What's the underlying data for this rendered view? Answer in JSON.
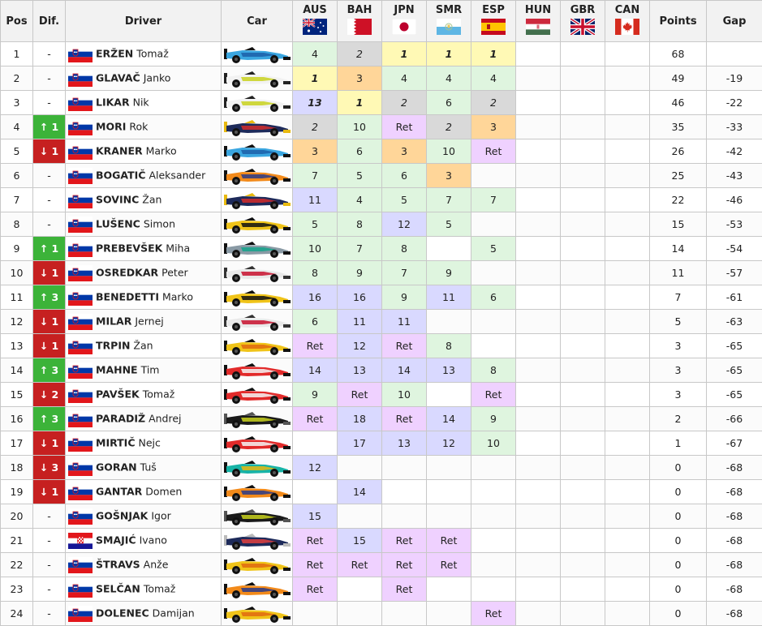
{
  "headers": {
    "pos": "Pos",
    "dif": "Dif.",
    "driver": "Driver",
    "car": "Car",
    "points": "Points",
    "gap": "Gap",
    "races": [
      {
        "code": "AUS",
        "flag": "au"
      },
      {
        "code": "BAH",
        "flag": "bh"
      },
      {
        "code": "JPN",
        "flag": "jp"
      },
      {
        "code": "SMR",
        "flag": "sm"
      },
      {
        "code": "ESP",
        "flag": "es"
      },
      {
        "code": "HUN",
        "flag": "hu"
      },
      {
        "code": "GBR",
        "flag": "gb"
      },
      {
        "code": "CAN",
        "flag": "ca"
      }
    ]
  },
  "colors": {
    "win": "#fff9b5",
    "second": "#d9d9d9",
    "third": "#ffd699",
    "points": "#dff5df",
    "finished": "#d9d9ff",
    "retired": "#efd1ff",
    "up": "#3cb339",
    "down": "#c62020"
  },
  "rows": [
    {
      "pos": "1",
      "dif": "-",
      "flag": "si",
      "surname": "ERŽEN",
      "given": "Tomaž",
      "car": {
        "body": "#3aa6e0",
        "accent": "#1c5fa8",
        "wing": "#111111"
      },
      "results": [
        {
          "v": "4",
          "c": "pts"
        },
        {
          "v": "2",
          "c": "p2"
        },
        {
          "v": "1",
          "c": "win"
        },
        {
          "v": "1",
          "c": "win"
        },
        {
          "v": "1",
          "c": "win"
        },
        {
          "v": "",
          "c": ""
        },
        {
          "v": "",
          "c": ""
        },
        {
          "v": "",
          "c": ""
        }
      ],
      "points": "68",
      "gap": ""
    },
    {
      "pos": "2",
      "dif": "-",
      "flag": "si",
      "surname": "GLAVAČ",
      "given": "Janko",
      "car": {
        "body": "#f2f2f2",
        "accent": "#c9d21e",
        "wing": "#222222"
      },
      "results": [
        {
          "v": "1",
          "c": "win"
        },
        {
          "v": "3",
          "c": "p3"
        },
        {
          "v": "4",
          "c": "pts"
        },
        {
          "v": "4",
          "c": "pts"
        },
        {
          "v": "4",
          "c": "pts"
        },
        {
          "v": "",
          "c": ""
        },
        {
          "v": "",
          "c": ""
        },
        {
          "v": "",
          "c": ""
        }
      ],
      "points": "49",
      "gap": "-19"
    },
    {
      "pos": "3",
      "dif": "-",
      "flag": "si",
      "surname": "LIKAR",
      "given": "Nik",
      "car": {
        "body": "#f2f2f2",
        "accent": "#c9d21e",
        "wing": "#222222"
      },
      "results": [
        {
          "v": "13",
          "c": "fin pole"
        },
        {
          "v": "1",
          "c": "win"
        },
        {
          "v": "2",
          "c": "p2"
        },
        {
          "v": "6",
          "c": "pts"
        },
        {
          "v": "2",
          "c": "p2"
        },
        {
          "v": "",
          "c": ""
        },
        {
          "v": "",
          "c": ""
        },
        {
          "v": "",
          "c": ""
        }
      ],
      "points": "46",
      "gap": "-22"
    },
    {
      "pos": "4",
      "dif": "↑ 1",
      "dir": "up",
      "flag": "si",
      "surname": "MORI",
      "given": "Rok",
      "car": {
        "body": "#1d2a5a",
        "accent": "#d32b2b",
        "wing": "#e8b90f"
      },
      "results": [
        {
          "v": "2",
          "c": "p2"
        },
        {
          "v": "10",
          "c": "pts"
        },
        {
          "v": "Ret",
          "c": "ret"
        },
        {
          "v": "2",
          "c": "p2"
        },
        {
          "v": "3",
          "c": "p3"
        },
        {
          "v": "",
          "c": ""
        },
        {
          "v": "",
          "c": ""
        },
        {
          "v": "",
          "c": ""
        }
      ],
      "points": "35",
      "gap": "-33"
    },
    {
      "pos": "5",
      "dif": "↓ 1",
      "dir": "down",
      "flag": "si",
      "surname": "KRANER",
      "given": "Marko",
      "car": {
        "body": "#3aa6e0",
        "accent": "#1c5fa8",
        "wing": "#111111"
      },
      "results": [
        {
          "v": "3",
          "c": "p3"
        },
        {
          "v": "6",
          "c": "pts"
        },
        {
          "v": "3",
          "c": "p3"
        },
        {
          "v": "10",
          "c": "pts"
        },
        {
          "v": "Ret",
          "c": "ret"
        },
        {
          "v": "",
          "c": ""
        },
        {
          "v": "",
          "c": ""
        },
        {
          "v": "",
          "c": ""
        }
      ],
      "points": "26",
      "gap": "-42"
    },
    {
      "pos": "6",
      "dif": "-",
      "flag": "si",
      "surname": "BOGATIČ",
      "given": "Aleksander",
      "car": {
        "body": "#f28a1a",
        "accent": "#2a3a8a",
        "wing": "#111111"
      },
      "results": [
        {
          "v": "7",
          "c": "pts"
        },
        {
          "v": "5",
          "c": "pts"
        },
        {
          "v": "6",
          "c": "pts"
        },
        {
          "v": "3",
          "c": "p3"
        },
        {
          "v": "",
          "c": ""
        },
        {
          "v": "",
          "c": ""
        },
        {
          "v": "",
          "c": ""
        },
        {
          "v": "",
          "c": ""
        }
      ],
      "points": "25",
      "gap": "-43"
    },
    {
      "pos": "7",
      "dif": "-",
      "flag": "si",
      "surname": "SOVINC",
      "given": "Žan",
      "car": {
        "body": "#1d2a5a",
        "accent": "#d32b2b",
        "wing": "#e8b90f"
      },
      "results": [
        {
          "v": "11",
          "c": "fin"
        },
        {
          "v": "4",
          "c": "pts"
        },
        {
          "v": "5",
          "c": "pts"
        },
        {
          "v": "7",
          "c": "pts"
        },
        {
          "v": "7",
          "c": "pts"
        },
        {
          "v": "",
          "c": ""
        },
        {
          "v": "",
          "c": ""
        },
        {
          "v": "",
          "c": ""
        }
      ],
      "points": "22",
      "gap": "-46"
    },
    {
      "pos": "8",
      "dif": "-",
      "flag": "si",
      "surname": "LUŠENC",
      "given": "Simon",
      "car": {
        "body": "#f0c419",
        "accent": "#111111",
        "wing": "#111111"
      },
      "results": [
        {
          "v": "5",
          "c": "pts"
        },
        {
          "v": "8",
          "c": "pts"
        },
        {
          "v": "12",
          "c": "fin"
        },
        {
          "v": "5",
          "c": "pts"
        },
        {
          "v": "",
          "c": ""
        },
        {
          "v": "",
          "c": ""
        },
        {
          "v": "",
          "c": ""
        },
        {
          "v": "",
          "c": ""
        }
      ],
      "points": "15",
      "gap": "-53"
    },
    {
      "pos": "9",
      "dif": "↑ 1",
      "dir": "up",
      "flag": "si",
      "surname": "PREBEVŠEK",
      "given": "Miha",
      "car": {
        "body": "#8a9aa5",
        "accent": "#14a38b",
        "wing": "#111111"
      },
      "results": [
        {
          "v": "10",
          "c": "pts"
        },
        {
          "v": "7",
          "c": "pts"
        },
        {
          "v": "8",
          "c": "pts"
        },
        {
          "v": "",
          "c": ""
        },
        {
          "v": "5",
          "c": "pts"
        },
        {
          "v": "",
          "c": ""
        },
        {
          "v": "",
          "c": ""
        },
        {
          "v": "",
          "c": ""
        }
      ],
      "points": "14",
      "gap": "-54"
    },
    {
      "pos": "10",
      "dif": "↓ 1",
      "dir": "down",
      "flag": "si",
      "surname": "OSREDKAR",
      "given": "Peter",
      "car": {
        "body": "#e9e9e9",
        "accent": "#c8102e",
        "wing": "#333333"
      },
      "results": [
        {
          "v": "8",
          "c": "pts"
        },
        {
          "v": "9",
          "c": "pts"
        },
        {
          "v": "7",
          "c": "pts"
        },
        {
          "v": "9",
          "c": "pts"
        },
        {
          "v": "",
          "c": ""
        },
        {
          "v": "",
          "c": ""
        },
        {
          "v": "",
          "c": ""
        },
        {
          "v": "",
          "c": ""
        }
      ],
      "points": "11",
      "gap": "-57"
    },
    {
      "pos": "11",
      "dif": "↑ 3",
      "dir": "up",
      "flag": "si",
      "surname": "BENEDETTI",
      "given": "Marko",
      "car": {
        "body": "#f0c419",
        "accent": "#111111",
        "wing": "#111111"
      },
      "results": [
        {
          "v": "16",
          "c": "fin"
        },
        {
          "v": "16",
          "c": "fin"
        },
        {
          "v": "9",
          "c": "pts"
        },
        {
          "v": "11",
          "c": "fin"
        },
        {
          "v": "6",
          "c": "pts"
        },
        {
          "v": "",
          "c": ""
        },
        {
          "v": "",
          "c": ""
        },
        {
          "v": "",
          "c": ""
        }
      ],
      "points": "7",
      "gap": "-61"
    },
    {
      "pos": "12",
      "dif": "↓ 1",
      "dir": "down",
      "flag": "si",
      "surname": "MILAR",
      "given": "Jernej",
      "car": {
        "body": "#e9e9e9",
        "accent": "#c8102e",
        "wing": "#333333"
      },
      "results": [
        {
          "v": "6",
          "c": "pts"
        },
        {
          "v": "11",
          "c": "fin"
        },
        {
          "v": "11",
          "c": "fin"
        },
        {
          "v": "",
          "c": ""
        },
        {
          "v": "",
          "c": ""
        },
        {
          "v": "",
          "c": ""
        },
        {
          "v": "",
          "c": ""
        },
        {
          "v": "",
          "c": ""
        }
      ],
      "points": "5",
      "gap": "-63"
    },
    {
      "pos": "13",
      "dif": "↓ 1",
      "dir": "down",
      "flag": "si",
      "surname": "TRPIN",
      "given": "Žan",
      "car": {
        "body": "#f0c419",
        "accent": "#e06a10",
        "wing": "#111111"
      },
      "results": [
        {
          "v": "Ret",
          "c": "ret"
        },
        {
          "v": "12",
          "c": "fin"
        },
        {
          "v": "Ret",
          "c": "ret"
        },
        {
          "v": "8",
          "c": "pts"
        },
        {
          "v": "",
          "c": ""
        },
        {
          "v": "",
          "c": ""
        },
        {
          "v": "",
          "c": ""
        },
        {
          "v": "",
          "c": ""
        }
      ],
      "points": "3",
      "gap": "-65"
    },
    {
      "pos": "14",
      "dif": "↑ 3",
      "dir": "up",
      "flag": "si",
      "surname": "MAHNE",
      "given": "Tim",
      "car": {
        "body": "#e22a2a",
        "accent": "#f5f5f5",
        "wing": "#111111"
      },
      "results": [
        {
          "v": "14",
          "c": "fin"
        },
        {
          "v": "13",
          "c": "fin"
        },
        {
          "v": "14",
          "c": "fin"
        },
        {
          "v": "13",
          "c": "fin"
        },
        {
          "v": "8",
          "c": "pts"
        },
        {
          "v": "",
          "c": ""
        },
        {
          "v": "",
          "c": ""
        },
        {
          "v": "",
          "c": ""
        }
      ],
      "points": "3",
      "gap": "-65"
    },
    {
      "pos": "15",
      "dif": "↓ 2",
      "dir": "down",
      "flag": "si",
      "surname": "PAVŠEK",
      "given": "Tomaž",
      "car": {
        "body": "#e22a2a",
        "accent": "#f5f5f5",
        "wing": "#111111"
      },
      "results": [
        {
          "v": "9",
          "c": "pts"
        },
        {
          "v": "Ret",
          "c": "ret"
        },
        {
          "v": "10",
          "c": "pts"
        },
        {
          "v": "",
          "c": ""
        },
        {
          "v": "Ret",
          "c": "ret"
        },
        {
          "v": "",
          "c": ""
        },
        {
          "v": "",
          "c": ""
        },
        {
          "v": "",
          "c": ""
        }
      ],
      "points": "3",
      "gap": "-65"
    },
    {
      "pos": "16",
      "dif": "↑ 3",
      "dir": "up",
      "flag": "si",
      "surname": "PARADIŽ",
      "given": "Andrej",
      "car": {
        "body": "#1a1a1a",
        "accent": "#c9d21e",
        "wing": "#555555"
      },
      "results": [
        {
          "v": "Ret",
          "c": "ret"
        },
        {
          "v": "18",
          "c": "fin"
        },
        {
          "v": "Ret",
          "c": "ret"
        },
        {
          "v": "14",
          "c": "fin"
        },
        {
          "v": "9",
          "c": "pts"
        },
        {
          "v": "",
          "c": ""
        },
        {
          "v": "",
          "c": ""
        },
        {
          "v": "",
          "c": ""
        }
      ],
      "points": "2",
      "gap": "-66"
    },
    {
      "pos": "17",
      "dif": "↓ 1",
      "dir": "down",
      "flag": "si",
      "surname": "MIRTIČ",
      "given": "Nejc",
      "car": {
        "body": "#e22a2a",
        "accent": "#f5f5f5",
        "wing": "#111111"
      },
      "results": [
        {
          "v": "",
          "c": ""
        },
        {
          "v": "17",
          "c": "fin"
        },
        {
          "v": "13",
          "c": "fin"
        },
        {
          "v": "12",
          "c": "fin"
        },
        {
          "v": "10",
          "c": "pts"
        },
        {
          "v": "",
          "c": ""
        },
        {
          "v": "",
          "c": ""
        },
        {
          "v": "",
          "c": ""
        }
      ],
      "points": "1",
      "gap": "-67"
    },
    {
      "pos": "18",
      "dif": "↓ 3",
      "dir": "down",
      "flag": "si",
      "surname": "GORAN",
      "given": "Tuš",
      "car": {
        "body": "#17b3a6",
        "accent": "#e8b90f",
        "wing": "#111111"
      },
      "results": [
        {
          "v": "12",
          "c": "fin"
        },
        {
          "v": "",
          "c": ""
        },
        {
          "v": "",
          "c": ""
        },
        {
          "v": "",
          "c": ""
        },
        {
          "v": "",
          "c": ""
        },
        {
          "v": "",
          "c": ""
        },
        {
          "v": "",
          "c": ""
        },
        {
          "v": "",
          "c": ""
        }
      ],
      "points": "0",
      "gap": "-68"
    },
    {
      "pos": "19",
      "dif": "↓ 1",
      "dir": "down",
      "flag": "si",
      "surname": "GANTAR",
      "given": "Domen",
      "car": {
        "body": "#f28a1a",
        "accent": "#2a3a8a",
        "wing": "#111111"
      },
      "results": [
        {
          "v": "",
          "c": ""
        },
        {
          "v": "14",
          "c": "fin"
        },
        {
          "v": "",
          "c": ""
        },
        {
          "v": "",
          "c": ""
        },
        {
          "v": "",
          "c": ""
        },
        {
          "v": "",
          "c": ""
        },
        {
          "v": "",
          "c": ""
        },
        {
          "v": "",
          "c": ""
        }
      ],
      "points": "0",
      "gap": "-68"
    },
    {
      "pos": "20",
      "dif": "-",
      "flag": "si",
      "surname": "GOŠNJAK",
      "given": "Igor",
      "car": {
        "body": "#1a1a1a",
        "accent": "#c9d21e",
        "wing": "#555555"
      },
      "results": [
        {
          "v": "15",
          "c": "fin"
        },
        {
          "v": "",
          "c": ""
        },
        {
          "v": "",
          "c": ""
        },
        {
          "v": "",
          "c": ""
        },
        {
          "v": "",
          "c": ""
        },
        {
          "v": "",
          "c": ""
        },
        {
          "v": "",
          "c": ""
        },
        {
          "v": "",
          "c": ""
        }
      ],
      "points": "0",
      "gap": "-68"
    },
    {
      "pos": "21",
      "dif": "-",
      "flag": "hr",
      "surname": "SMAJIĆ",
      "given": "Ivano",
      "car": {
        "body": "#1d2a5a",
        "accent": "#e04040",
        "wing": "#bbbbbb"
      },
      "results": [
        {
          "v": "Ret",
          "c": "ret"
        },
        {
          "v": "15",
          "c": "fin"
        },
        {
          "v": "Ret",
          "c": "ret"
        },
        {
          "v": "Ret",
          "c": "ret"
        },
        {
          "v": "",
          "c": ""
        },
        {
          "v": "",
          "c": ""
        },
        {
          "v": "",
          "c": ""
        },
        {
          "v": "",
          "c": ""
        }
      ],
      "points": "0",
      "gap": "-68"
    },
    {
      "pos": "22",
      "dif": "-",
      "flag": "si",
      "surname": "ŠTRAVS",
      "given": "Anže",
      "car": {
        "body": "#f0c419",
        "accent": "#e06a10",
        "wing": "#111111"
      },
      "results": [
        {
          "v": "Ret",
          "c": "ret"
        },
        {
          "v": "Ret",
          "c": "ret"
        },
        {
          "v": "Ret",
          "c": "ret"
        },
        {
          "v": "Ret",
          "c": "ret"
        },
        {
          "v": "",
          "c": ""
        },
        {
          "v": "",
          "c": ""
        },
        {
          "v": "",
          "c": ""
        },
        {
          "v": "",
          "c": ""
        }
      ],
      "points": "0",
      "gap": "-68"
    },
    {
      "pos": "23",
      "dif": "-",
      "flag": "si",
      "surname": "SELČAN",
      "given": "Tomaž",
      "car": {
        "body": "#f28a1a",
        "accent": "#2a3a8a",
        "wing": "#111111"
      },
      "results": [
        {
          "v": "Ret",
          "c": "ret"
        },
        {
          "v": "",
          "c": ""
        },
        {
          "v": "Ret",
          "c": "ret"
        },
        {
          "v": "",
          "c": ""
        },
        {
          "v": "",
          "c": ""
        },
        {
          "v": "",
          "c": ""
        },
        {
          "v": "",
          "c": ""
        },
        {
          "v": "",
          "c": ""
        }
      ],
      "points": "0",
      "gap": "-68"
    },
    {
      "pos": "24",
      "dif": "-",
      "flag": "si",
      "surname": "DOLENEC",
      "given": "Damijan",
      "car": {
        "body": "#f0c419",
        "accent": "#e06a10",
        "wing": "#111111"
      },
      "results": [
        {
          "v": "",
          "c": ""
        },
        {
          "v": "",
          "c": ""
        },
        {
          "v": "",
          "c": ""
        },
        {
          "v": "",
          "c": ""
        },
        {
          "v": "Ret",
          "c": "ret"
        },
        {
          "v": "",
          "c": ""
        },
        {
          "v": "",
          "c": ""
        },
        {
          "v": "",
          "c": ""
        }
      ],
      "points": "0",
      "gap": "-68"
    }
  ]
}
